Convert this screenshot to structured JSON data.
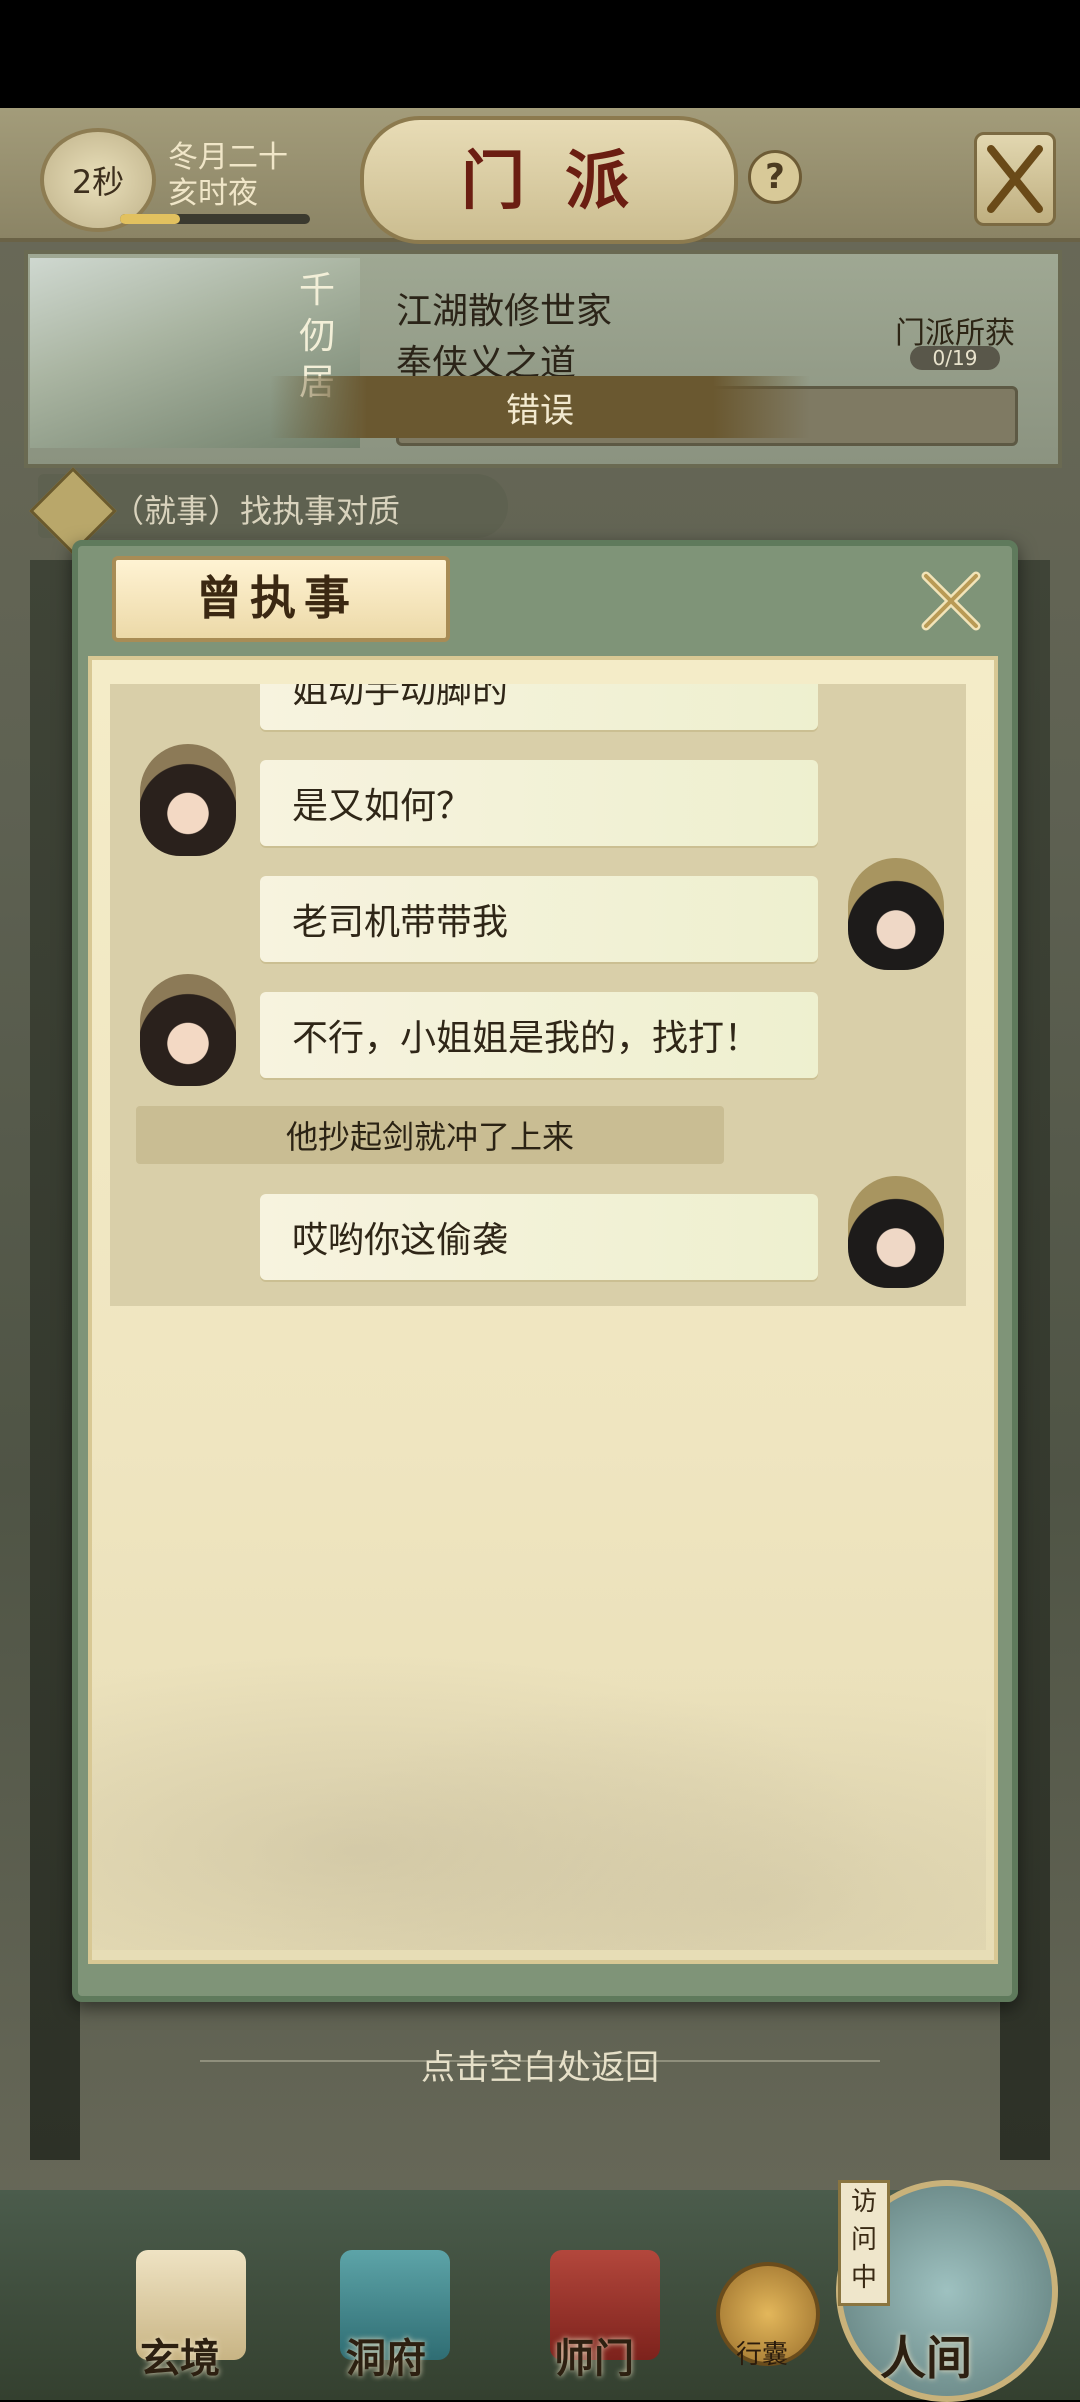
{
  "header": {
    "timer": "2秒",
    "date_line1": "冬月二十",
    "date_line2": "亥时夜",
    "title": "门派",
    "help_icon": "question-icon",
    "close_icon": "crossed-swords-icon"
  },
  "sect": {
    "vertical_name": "千仞居",
    "line1": "江湖散修世家",
    "line2": "奉侠义之道",
    "harvest_label": "门派所获",
    "harvest_count": "0/19"
  },
  "toast": "错误",
  "quest": {
    "text": "（就事）找执事对质"
  },
  "dialog": {
    "title": "曾执事",
    "close_icon": "close-icon",
    "messages": [
      {
        "speaker": "female",
        "side": "left",
        "text": "姐动手动脚的"
      },
      {
        "speaker": "female",
        "side": "left",
        "text": "是又如何？"
      },
      {
        "speaker": "male",
        "side": "right",
        "text": "老司机带带我"
      },
      {
        "speaker": "female",
        "side": "left",
        "text": "不行，小姐姐是我的，找打！"
      },
      {
        "speaker": "male",
        "side": "right",
        "text": "哎哟你这偷袭"
      }
    ],
    "narration": "他抄起剑就冲了上来"
  },
  "hint": "点击空白处返回",
  "bottom_nav": {
    "items": [
      {
        "label": "玄境",
        "icon": "scroll-icon"
      },
      {
        "label": "洞府",
        "icon": "pavilion-icon"
      },
      {
        "label": "师门",
        "icon": "banner-icon"
      },
      {
        "label": "行囊",
        "icon": "bag-icon"
      },
      {
        "label": "人间",
        "icon": "world-icon"
      }
    ],
    "visit_tag": "访问中"
  }
}
